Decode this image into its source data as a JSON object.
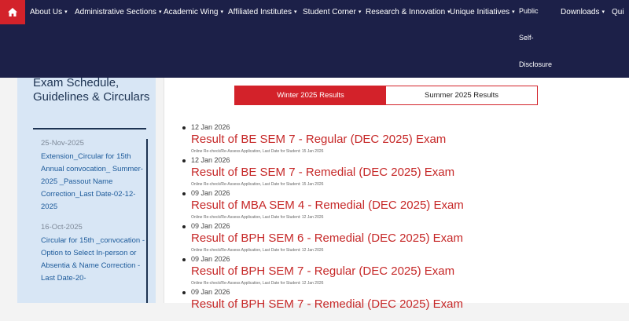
{
  "nav": {
    "home_icon": "home-icon",
    "items": [
      {
        "label": "About Us"
      },
      {
        "label": "Administrative Sections"
      },
      {
        "label": "Academic Wing"
      },
      {
        "label": "Affiliated Institutes"
      },
      {
        "label": "Student Corner"
      },
      {
        "label": "Research & Innovation"
      },
      {
        "label": "Unique Initiatives"
      }
    ],
    "public_lines": [
      "Public",
      "Self-",
      "Disclosure"
    ],
    "downloads": "Downloads",
    "cutoff": "Qui",
    "caret": "▾"
  },
  "sidebar": {
    "title": "Exam Schedule, Guidelines & Circulars",
    "items": [
      {
        "date": "25-Nov-2025",
        "text": "Extension_Circular for 15th Annual convocation_ Summer-2025 _Passout Name Correction_Last Date-02-12-2025"
      },
      {
        "date": "16-Oct-2025",
        "text": "Circular for 15th _convocation - Option to Select In-person or Absentia & Name Correction - Last Date-20-"
      }
    ]
  },
  "tabs": {
    "active": "Winter 2025 Results",
    "inactive": "Summer 2025 Results"
  },
  "results": [
    {
      "date": "12 Jan 2026",
      "title": "Result of BE SEM 7 - Regular (DEC 2025) Exam",
      "note": "Online Re-check/Re-Assess Application, Last Date for Student: 15 Jan 2026"
    },
    {
      "date": "12 Jan 2026",
      "title": "Result of BE SEM 7 - Remedial (DEC 2025) Exam",
      "note": "Online Re-check/Re-Assess Application, Last Date for Student: 15 Jan 2026"
    },
    {
      "date": "09 Jan 2026",
      "title": "Result of MBA SEM 4 - Remedial (DEC 2025) Exam",
      "note": "Online Re-check/Re-Assess Application, Last Date for Student: 12 Jan 2026"
    },
    {
      "date": "09 Jan 2026",
      "title": "Result of BPH SEM 6 - Remedial (DEC 2025) Exam",
      "note": "Online Re-check/Re-Assess Application, Last Date for Student: 12 Jan 2026"
    },
    {
      "date": "09 Jan 2026",
      "title": "Result of BPH SEM 7 - Regular (DEC 2025) Exam",
      "note": "Online Re-check/Re-Assess Application, Last Date for Student: 12 Jan 2026"
    },
    {
      "date": "09 Jan 2026",
      "title": "Result of BPH SEM 7 - Remedial (DEC 2025) Exam",
      "note": ""
    }
  ]
}
